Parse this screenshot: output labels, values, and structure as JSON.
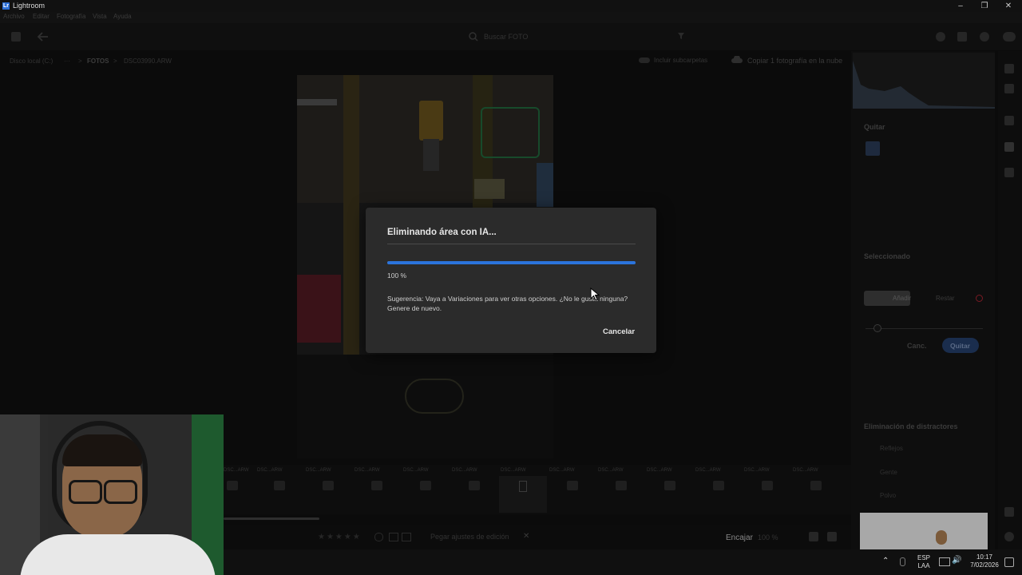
{
  "window": {
    "title": "Lightroom",
    "logo_letter": "Lr"
  },
  "menu": [
    "Archivo",
    "Editar",
    "Fotografía",
    "Vista",
    "Ayuda"
  ],
  "toolbar": {
    "search_placeholder": "Buscar FOTO"
  },
  "breadcrumb": {
    "drive": "Disco local (C:)",
    "ellipsis": "···",
    "folder": "FOTOS",
    "file": "DSC03990.ARW"
  },
  "view_options": {
    "include_subfolders": "Incluir subcarpetas",
    "copy_to_cloud": "Copiar 1 fotografía en la nube"
  },
  "right_panel": {
    "remove_section": "Quitar",
    "selected_section": "Seleccionado",
    "add_label": "Añadir",
    "subtract_label": "Restar",
    "cancel_label": "Canc.",
    "remove_button": "Quitar",
    "distraction_section": "Eliminación de distractores",
    "distraction_items": [
      "Reflejos",
      "Gente",
      "Polvo"
    ]
  },
  "filmstrip": {
    "files": [
      "DSC...ARW",
      "DSC...ARW",
      "DSC...ARW",
      "DSC...ARW",
      "DSC...ARW",
      "DSC...ARW",
      "DSC...ARW",
      "DSC...ARW",
      "DSC...ARW",
      "DSC...ARW",
      "DSC...ARW",
      "DSC...ARW",
      "DSC...ARW"
    ]
  },
  "bottom_bar": {
    "paste_settings": "Pegar ajustes de edición",
    "fit_label": "Encajar",
    "zoom_value": "100 %"
  },
  "dialog": {
    "title": "Eliminando área con IA...",
    "progress": 1.0,
    "progress_label": "100 %",
    "tip": "Sugerencia: Vaya a Variaciones para ver otras opciones. ¿No le gusta ninguna? Genere de nuevo.",
    "cancel_label": "Cancelar"
  },
  "taskbar": {
    "language_top": "ESP",
    "language_bottom": "LAA",
    "time": "10:17",
    "date": "7/02/2026"
  },
  "colors": {
    "accent": "#2b74dc",
    "dialog_bg": "#2b2b2b",
    "background": "#0b0b0b"
  }
}
